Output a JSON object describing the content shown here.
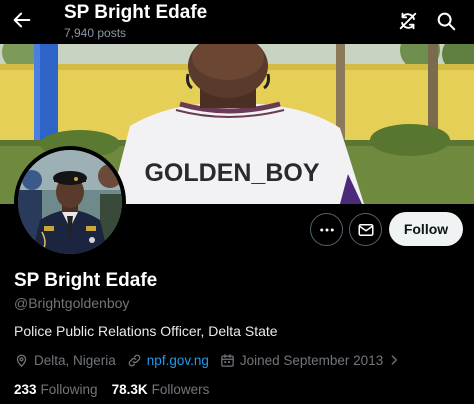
{
  "header": {
    "title": "SP Bright Edafe",
    "posts_count": "7,940 posts"
  },
  "banner": {
    "shirt_text": "GOLDEN_BOY",
    "colors": {
      "wall": "#e6cf57",
      "grass": "#6f8a3e",
      "shirt": "#f2f2f4",
      "skin": "#5a3a2a",
      "sky": "#dfe8ee"
    }
  },
  "actions": {
    "follow_label": "Follow",
    "more_icon": "more-icon",
    "message_icon": "mail-icon"
  },
  "profile": {
    "name": "SP Bright Edafe",
    "handle": "@Brightgoldenboy",
    "bio": "Police Public Relations Officer, Delta State",
    "location": "Delta, Nigeria",
    "website": "npf.gov.ng",
    "joined": "Joined September 2013"
  },
  "stats": {
    "following_count": "233",
    "following_label": "Following",
    "followers_count": "78.3K",
    "followers_label": "Followers"
  },
  "colors": {
    "background": "#000000",
    "link": "#1d9bf0",
    "muted": "#71767b",
    "follow_bg": "#eff3f4"
  }
}
